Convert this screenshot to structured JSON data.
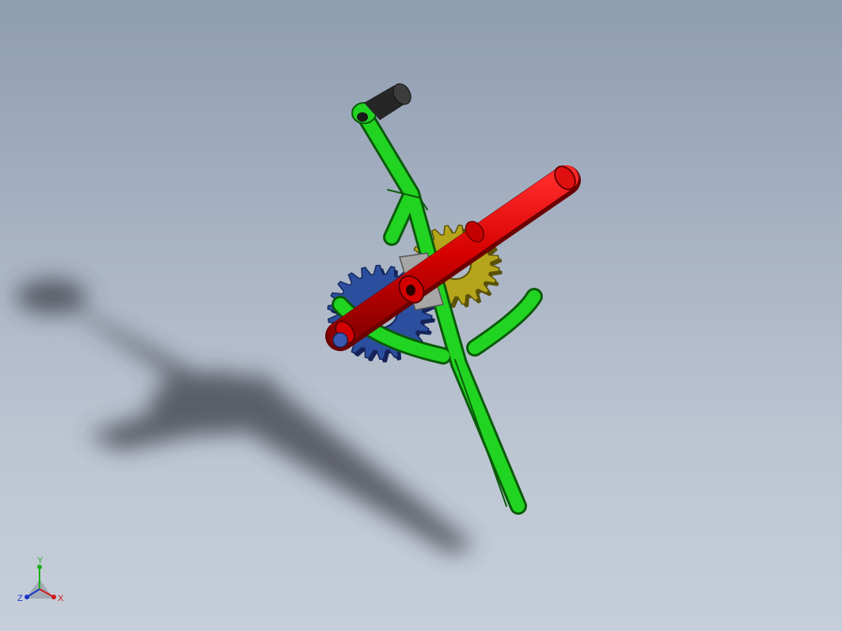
{
  "view": {
    "background_top": "#8f9db1",
    "background_bottom": "#c6ced9"
  },
  "model": {
    "parts": [
      {
        "name": "crank-frame",
        "color": "#1fd11f"
      },
      {
        "name": "handle-rod",
        "color": "#d40000"
      },
      {
        "name": "drive-gear",
        "color": "#2b4f9e"
      },
      {
        "name": "driven-gear",
        "color": "#b5a51a"
      },
      {
        "name": "grip-knob",
        "color": "#2a2a2a"
      },
      {
        "name": "hub-block",
        "color": "#9a9a9a"
      }
    ]
  },
  "triad": {
    "x_label": "X",
    "y_label": "Y",
    "z_label": "Z",
    "x_color": "#d01818",
    "y_color": "#18b018",
    "z_color": "#1838c8"
  }
}
